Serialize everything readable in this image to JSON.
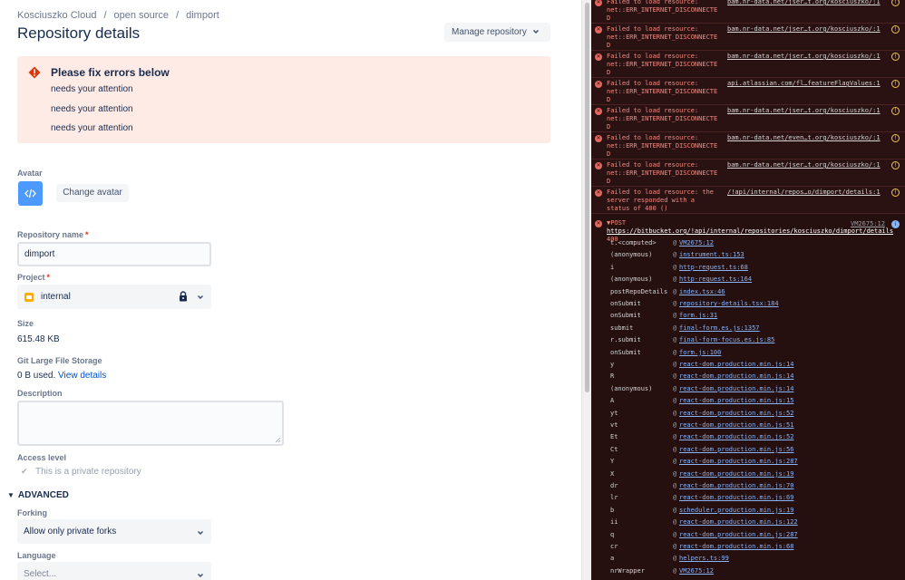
{
  "breadcrumb": [
    "Kosciuszko Cloud",
    "open source",
    "dimport"
  ],
  "breadcrumb_separator": "/",
  "page_title": "Repository details",
  "manage_button": "Manage repository",
  "error_box": {
    "title": "Please fix errors below",
    "lines": [
      "needs your attention",
      "needs your attention",
      "needs your attention"
    ]
  },
  "avatar_label": "Avatar",
  "change_avatar": "Change avatar",
  "repo_name_label": "Repository name",
  "required_mark": "*",
  "repo_name_value": "dimport",
  "project_label": "Project",
  "project_value": "internal",
  "size_label": "Size",
  "size_value": "615.48 KB",
  "lfs_label": "Git Large File Storage",
  "lfs_used": "0 B used.",
  "lfs_link": "View details",
  "description_label": "Description",
  "access_label": "Access level",
  "access_checkbox": "This is a private repository",
  "advanced_label": "ADVANCED",
  "forking_label": "Forking",
  "forking_value": "Allow only private forks",
  "language_label": "Language",
  "language_placeholder": "Select...",
  "console": {
    "errors": [
      {
        "msg": "Failed to load resource:\nnet::ERR_INTERNET_DISCONNECTE\nD",
        "url": "bam.nr-data.net/jser…t.org/kosciuszko/:1"
      },
      {
        "msg": "Failed to load resource:\nnet::ERR_INTERNET_DISCONNECTE\nD",
        "url": "bam.nr-data.net/jser…t.org/kosciuszko/:1"
      },
      {
        "msg": "Failed to load resource:\nnet::ERR_INTERNET_DISCONNECTE\nD",
        "url": "bam.nr-data.net/jser…t.org/kosciuszko/:1"
      },
      {
        "msg": "Failed to load resource:\nnet::ERR_INTERNET_DISCONNECTE\nD",
        "url": "api.atlassian.com/fl…featureFlagValues:1"
      },
      {
        "msg": "Failed to load resource:\nnet::ERR_INTERNET_DISCONNECTE\nD",
        "url": "bam.nr-data.net/jser…t.org/kosciuszko/:1"
      },
      {
        "msg": "Failed to load resource:\nnet::ERR_INTERNET_DISCONNECTE\nD",
        "url": "bam.nr-data.net/even…t.org/kosciuszko/:1"
      },
      {
        "msg": "Failed to load resource:\nnet::ERR_INTERNET_DISCONNECTE\nD",
        "url": "bam.nr-data.net/jser…t.org/kosciuszko/:1"
      },
      {
        "msg": "Failed to load resource: the\nserver responded with a\nstatus of 400 ()",
        "url": "/!api/internal/repos…o/dimport/details:1"
      }
    ],
    "post": {
      "method": "POST",
      "url": "https://bitbucket.org/!api/internal/repositories/kosciuszko/dimport/details",
      "status": "400",
      "source": "VM2675:12"
    },
    "stack": [
      {
        "fn": "t.<computed>",
        "loc": "VM2675:12"
      },
      {
        "fn": "(anonymous)",
        "loc": "instrument.ts:153"
      },
      {
        "fn": "i",
        "loc": "http-request.ts:68"
      },
      {
        "fn": "(anonymous)",
        "loc": "http-request.ts:164"
      },
      {
        "fn": "postRepoDetails",
        "loc": "index.tsx:46"
      },
      {
        "fn": "onSubmit",
        "loc": "repository-details.tsx:184"
      },
      {
        "fn": "onSubmit",
        "loc": "form.js:31"
      },
      {
        "fn": "submit",
        "loc": "final-form.es.js:1357"
      },
      {
        "fn": "r.submit",
        "loc": "final-form-focus.es.js:85"
      },
      {
        "fn": "onSubmit",
        "loc": "form.js:100"
      },
      {
        "fn": "y",
        "loc": "react-dom.production.min.js:14"
      },
      {
        "fn": "R",
        "loc": "react-dom.production.min.js:14"
      },
      {
        "fn": "(anonymous)",
        "loc": "react-dom.production.min.js:14"
      },
      {
        "fn": "A",
        "loc": "react-dom.production.min.js:15"
      },
      {
        "fn": "yt",
        "loc": "react-dom.production.min.js:52"
      },
      {
        "fn": "vt",
        "loc": "react-dom.production.min.js:51"
      },
      {
        "fn": "Et",
        "loc": "react-dom.production.min.js:52"
      },
      {
        "fn": "Ct",
        "loc": "react-dom.production.min.js:56"
      },
      {
        "fn": "Y",
        "loc": "react-dom.production.min.js:287"
      },
      {
        "fn": "X",
        "loc": "react-dom.production.min.js:19"
      },
      {
        "fn": "dr",
        "loc": "react-dom.production.min.js:70"
      },
      {
        "fn": "lr",
        "loc": "react-dom.production.min.js:69"
      },
      {
        "fn": "b",
        "loc": "scheduler.production.min.js:19"
      },
      {
        "fn": "ii",
        "loc": "react-dom.production.min.js:122"
      },
      {
        "fn": "q",
        "loc": "react-dom.production.min.js:287"
      },
      {
        "fn": "cr",
        "loc": "react-dom.production.min.js:68"
      },
      {
        "fn": "a",
        "loc": "helpers.ts:99"
      },
      {
        "fn": "nrWrapper",
        "loc": "VM2675:12"
      }
    ]
  }
}
